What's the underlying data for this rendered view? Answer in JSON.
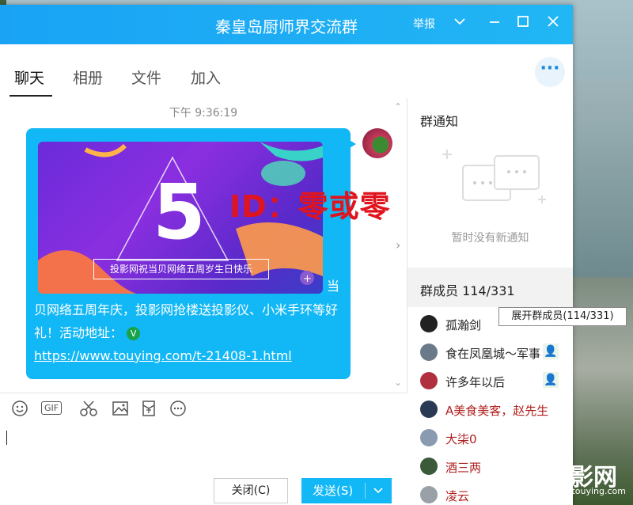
{
  "window": {
    "title": "秦皇岛厨师界交流群",
    "report_label": "举报"
  },
  "tabs": [
    {
      "label": "聊天",
      "active": true
    },
    {
      "label": "相册",
      "active": false
    },
    {
      "label": "文件",
      "active": false
    },
    {
      "label": "加入",
      "active": false
    }
  ],
  "more_icon": "···",
  "chat": {
    "timestamp": "下午 9:36:19",
    "banner_caption": "投影网祝当贝网络五周岁生日快乐",
    "banner_big_char": "5",
    "message_lead": "当",
    "message_body": "贝网络五周年庆，投影网抢楼送投影仪、小米手环等好礼！活动地址：",
    "message_verified_icon": "V",
    "message_link": "https://www.touying.com/t-21408-1.html"
  },
  "overlay_watermark": "ID：零或零",
  "toolbar": {
    "icons": [
      "emoji-icon",
      "gif-icon",
      "scissors-icon",
      "image-icon",
      "redpacket-icon",
      "more-icon"
    ],
    "gif_label": "GIF"
  },
  "buttons": {
    "close_label": "关闭(C)",
    "send_label": "发送(S)"
  },
  "sidebar": {
    "notice_title": "群通知",
    "notice_empty": "暂时没有新通知",
    "members_title": "群成员 114/331",
    "members_tooltip": "展开群成员(114/331)",
    "members": [
      {
        "name": "孤瀚剑",
        "color": "#222222",
        "badge": false
      },
      {
        "name": "食在凤凰城～军事",
        "color": "#222222",
        "badge": true
      },
      {
        "name": "许多年以后",
        "color": "#222222",
        "badge": true
      },
      {
        "name": "A美食美客，赵先生",
        "color": "#b0201e",
        "badge": false
      },
      {
        "name": "大柒0",
        "color": "#b0201e",
        "badge": false
      },
      {
        "name": "酒三两",
        "color": "#b0201e",
        "badge": false
      },
      {
        "name": "凌云",
        "color": "#b0201e",
        "badge": false
      }
    ]
  },
  "logo": {
    "text": "投影网",
    "url": "www.touying.com"
  }
}
